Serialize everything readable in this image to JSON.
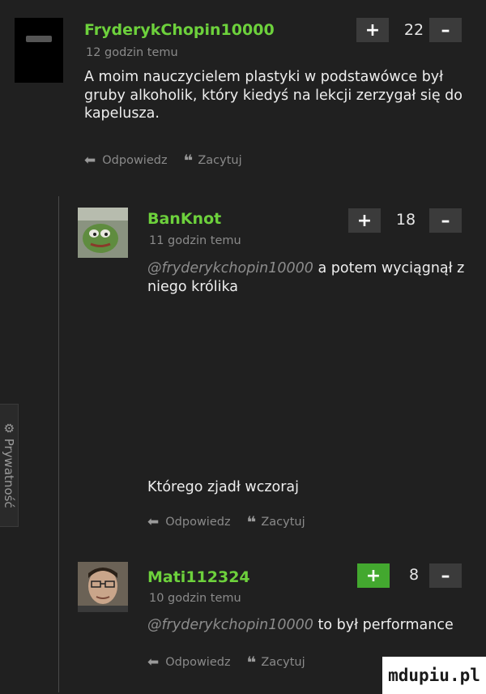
{
  "sidebar": {
    "privacy_label": "Prywatność",
    "privacy_icon": "gear-icon"
  },
  "comments": [
    {
      "username": "FryderykChopin10000",
      "time": "12 godzin temu",
      "text": "A moim nauczycielem plastyki w podstawówce był gruby alkoholik, który kiedyś na lekcji zerzygał się do kapelusza.",
      "score": "22",
      "upvote_label": "+",
      "downvote_label": "–",
      "reply_label": "Odpowiedz",
      "quote_label": "Zacytuj"
    },
    {
      "username": "BanKnot",
      "time": "11 godzin temu",
      "mention": "@fryderykchopin10000",
      "text": " a potem wyciągnął z niego królika",
      "text2": "Którego zjadł wczoraj",
      "score": "18",
      "upvote_label": "+",
      "downvote_label": "–",
      "reply_label": "Odpowiedz",
      "quote_label": "Zacytuj"
    },
    {
      "username": "Mati112324",
      "time": "10 godzin temu",
      "mention": "@fryderykchopin10000",
      "text": " to był performance",
      "score": "8",
      "upvote_label": "+",
      "downvote_label": "–",
      "reply_label": "Odpowiedz",
      "quote_label": "Zacytuj",
      "upvote_active": true
    }
  ],
  "watermark": "mdupiu.pl",
  "colors": {
    "username": "#6dd13c",
    "upvote_active": "#43a82f",
    "background": "#202020"
  }
}
